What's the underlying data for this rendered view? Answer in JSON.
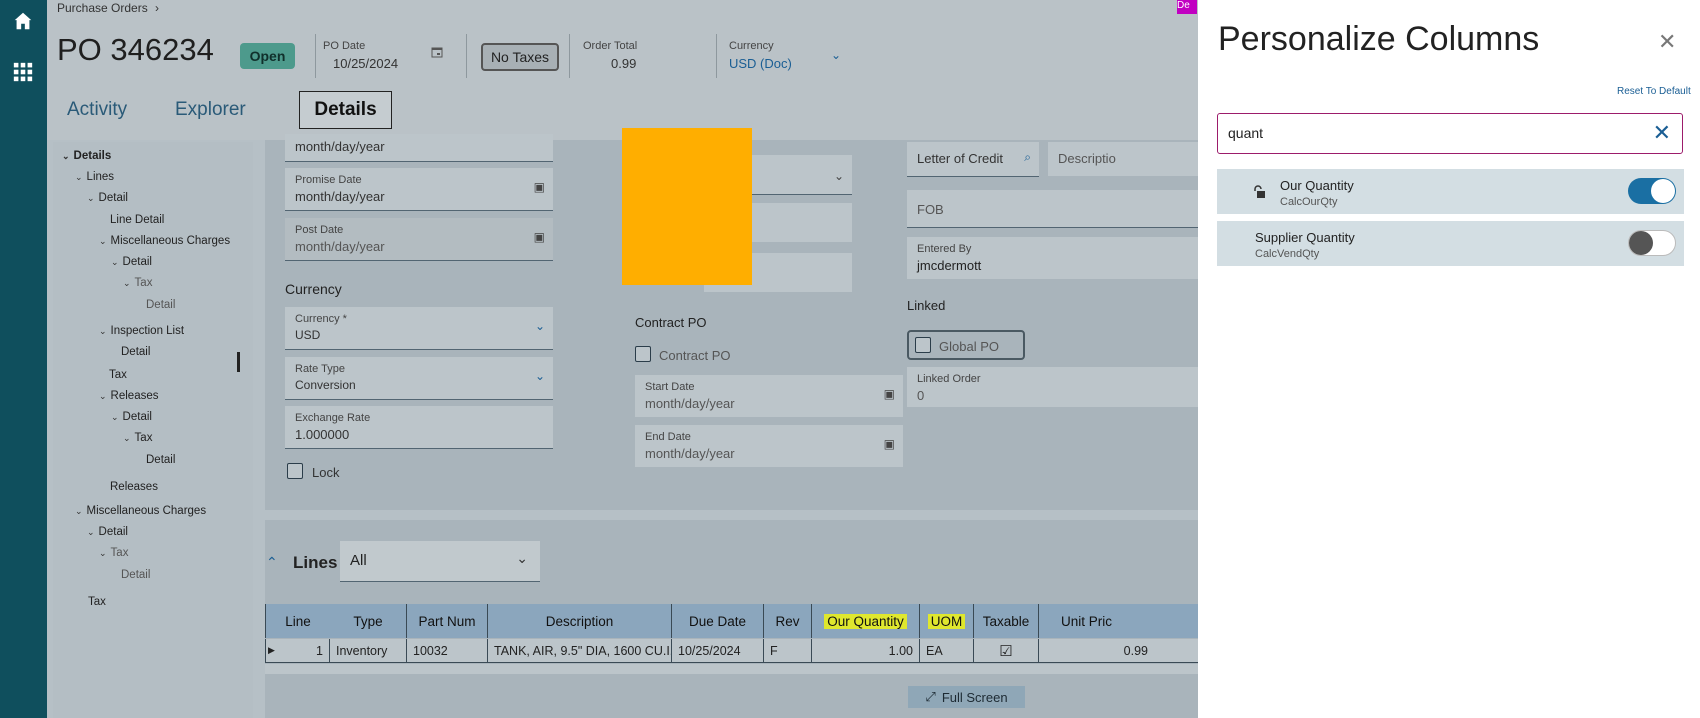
{
  "breadcrumb": {
    "label": "Purchase Orders",
    "sep": "›"
  },
  "header": {
    "po_title": "PO 346234",
    "status": "Open",
    "po_date_label": "PO Date",
    "po_date_value": "10/25/2024",
    "no_taxes": "No Taxes",
    "order_total_label": "Order Total",
    "order_total_value": "0.99",
    "currency_label": "Currency",
    "currency_value": "USD (Doc)"
  },
  "tabs": {
    "activity": "Activity",
    "explorer": "Explorer",
    "details": "Details"
  },
  "tree": [
    "Details",
    "Lines",
    "Detail",
    "Line Detail",
    "Miscellaneous Charges",
    "Detail",
    "Tax",
    "Detail",
    "Inspection List",
    "Detail",
    "Tax",
    "Releases",
    "Detail",
    "Tax",
    "Detail",
    "Releases",
    "Miscellaneous Charges",
    "Detail",
    "Tax",
    "Detail",
    "Tax"
  ],
  "form": {
    "top_date_value": "month/day/year",
    "promise_date_label": "Promise Date",
    "promise_date_value": "month/day/year",
    "post_date_label": "Post Date",
    "post_date_value": "month/day/year",
    "currency_section": "Currency",
    "currency_field_label": "Currency *",
    "currency_field_value": "USD",
    "rate_type_label": "Rate Type",
    "rate_type_value": "Conversion",
    "exchange_rate_label": "Exchange Rate",
    "exchange_rate_value": "1.000000",
    "lock_label": "Lock",
    "contract_po_section": "Contract PO",
    "contract_po_checkbox": "Contract PO",
    "start_date_label": "Start Date",
    "start_date_value": "month/day/year",
    "end_date_label": "End Date",
    "end_date_value": "month/day/year",
    "letter_of_credit": "Letter of Credit",
    "description": "Descriptio",
    "fob": "FOB",
    "entered_by_label": "Entered By",
    "entered_by_value": "jmcdermott",
    "linked_section": "Linked",
    "global_po": "Global PO",
    "linked_order_label": "Linked Order",
    "linked_order_value": "0"
  },
  "lines": {
    "title": "Lines",
    "filter_value": "All",
    "columns": [
      "Line",
      "Type",
      "Part Num",
      "Description",
      "Due Date",
      "Rev",
      "Our Quantity",
      "UOM",
      "Taxable",
      "Unit Pric"
    ],
    "row": [
      "1",
      "Inventory",
      "10032",
      "TANK, AIR, 9.5\" DIA, 1600 CU.I...",
      "10/25/2024",
      "F",
      "1.00",
      "EA",
      "",
      "0.99"
    ],
    "full_screen": "Full Screen"
  },
  "corner_tag": "De",
  "panel": {
    "title": "Personalize Columns",
    "reset": "Reset To Default",
    "search_value": "quant",
    "items": [
      {
        "name": "Our Quantity",
        "sub": "CalcOurQty",
        "enabled": true
      },
      {
        "name": "Supplier Quantity",
        "sub": "CalcVendQty",
        "enabled": false
      }
    ]
  },
  "colors": {
    "rail": "#0f4f5d",
    "accent": "#1a6fa3",
    "search_border": "#9c1c6b",
    "highlight": "#dfe72e",
    "status_green": "#4d9a8c"
  }
}
